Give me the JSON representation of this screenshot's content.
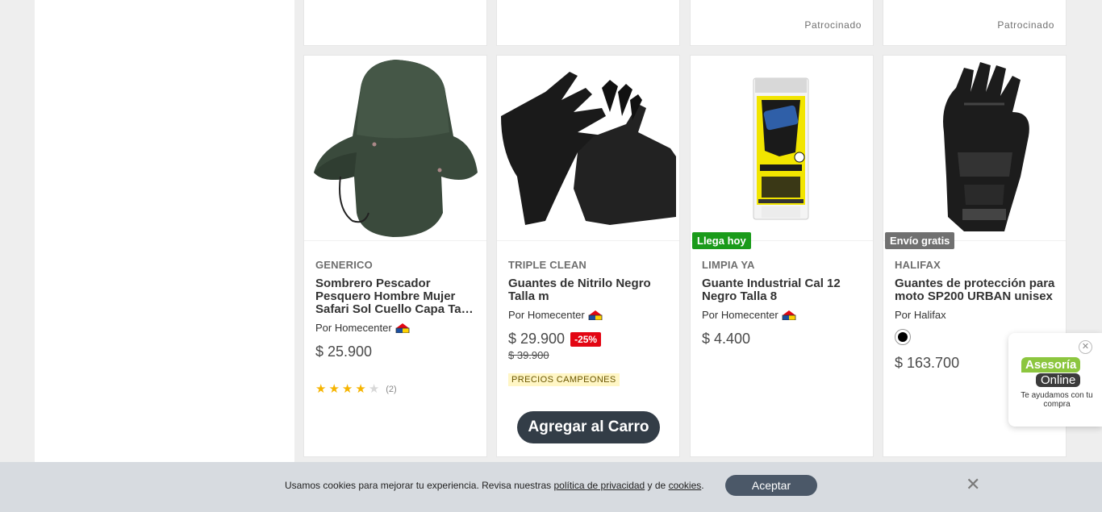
{
  "top_row": [
    {
      "sponsored": ""
    },
    {
      "sponsored": ""
    },
    {
      "sponsored": "Patrocinado"
    },
    {
      "sponsored": "Patrocinado"
    }
  ],
  "products": [
    {
      "brand": "GENERICO",
      "title": "Sombrero Pescador Pesquero Hombre Mujer Safari Sol Cuello Capa Tapa Proteccion",
      "seller": "Por Homecenter",
      "price": "$ 25.900",
      "rating_count": "(2)",
      "rating": 4,
      "image_icon": "bucket-hat"
    },
    {
      "brand": "TRIPLE CLEAN",
      "title": "Guantes de Nitrilo Negro Talla m",
      "seller": "Por Homecenter",
      "price": "$ 29.900",
      "discount": "-25%",
      "old_price": "$ 39.900",
      "promo": "PRECIOS CAMPEONES",
      "add_to_cart": "Agregar al Carro",
      "image_icon": "nitrile-gloves"
    },
    {
      "brand": "LIMPIA YA",
      "title": "Guante Industrial Cal 12 Negro Talla 8",
      "seller": "Por Homecenter",
      "price": "$ 4.400",
      "badge": "Llega hoy",
      "image_icon": "glove-package"
    },
    {
      "brand": "HALIFAX",
      "title": "Guantes de protección para moto SP200 URBAN unisex",
      "seller": "Por Halifax",
      "price": "$ 163.700",
      "badge": "Envío gratis",
      "swatch_color": "#000000",
      "image_icon": "moto-glove"
    }
  ],
  "cookie_bar": {
    "text_before": "Usamos cookies para mejorar tu experiencia. Revisa nuestras ",
    "privacy_link": "política de privacidad",
    "text_middle": " y de ",
    "cookies_link": "cookies",
    "text_after": ".",
    "accept": "Aceptar",
    "close": "✕"
  },
  "chat": {
    "close": "✕",
    "logo_top": "Asesoría",
    "logo_bottom": "Online",
    "text": "Te ayudamos con tu compra"
  },
  "colors": {
    "button_dark": "#333d47",
    "discount_red": "#e30613",
    "badge_green": "#1a9b1a",
    "badge_gray": "#707070",
    "chat_green": "#8cc63f"
  }
}
